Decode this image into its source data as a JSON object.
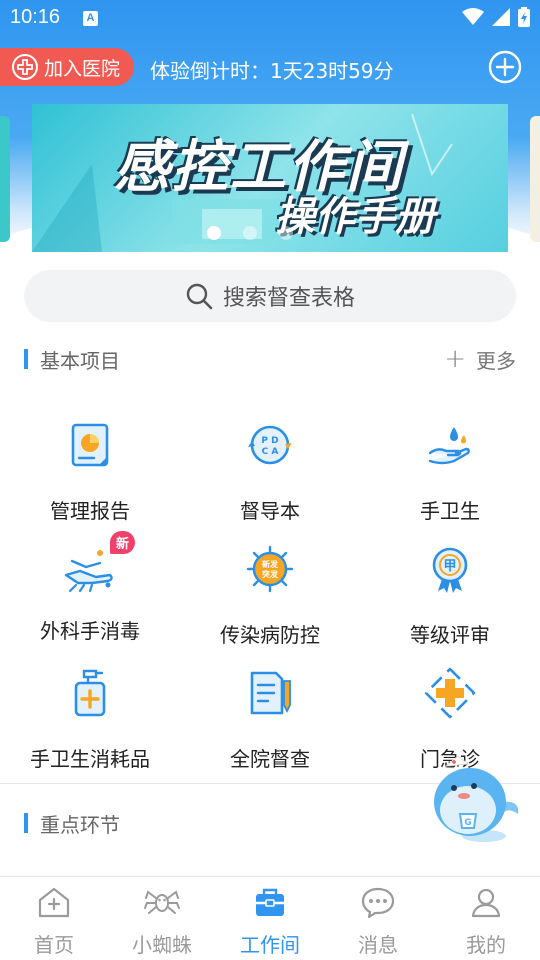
{
  "status_bar": {
    "time": "10:16",
    "notif_letter": "A"
  },
  "header": {
    "join_label": "加入医院",
    "trial_countdown": "体验倒计时：1天23时59分"
  },
  "banner": {
    "title_line1": "感控工作间",
    "title_line2": "操作手册",
    "slide_count": 3,
    "active_slide": 1
  },
  "search": {
    "placeholder": "搜索督查表格"
  },
  "section_basic": {
    "title": "基本项目",
    "more_label": "更多"
  },
  "grid_items": [
    {
      "label": "管理报告",
      "icon": "report-icon"
    },
    {
      "label": "督导本",
      "icon": "pdca-icon"
    },
    {
      "label": "手卫生",
      "icon": "hand-hygiene-icon"
    },
    {
      "label": "外科手消毒",
      "icon": "surgical-hand-icon",
      "badge": "新"
    },
    {
      "label": "传染病防控",
      "icon": "virus-icon",
      "icon_text": "新发\n突发"
    },
    {
      "label": "等级评审",
      "icon": "grade-medal-icon",
      "icon_text": "甲"
    },
    {
      "label": "手卫生消耗品",
      "icon": "sanitizer-bottle-icon"
    },
    {
      "label": "全院督查",
      "icon": "document-pen-icon"
    },
    {
      "label": "门急诊",
      "icon": "emergency-cross-icon"
    }
  ],
  "section_key": {
    "title": "重点环节"
  },
  "bottom_nav": [
    {
      "label": "首页",
      "icon": "home-icon",
      "active": false
    },
    {
      "label": "小蜘蛛",
      "icon": "spider-icon",
      "active": false
    },
    {
      "label": "工作间",
      "icon": "toolbox-icon",
      "active": true
    },
    {
      "label": "消息",
      "icon": "message-icon",
      "active": false
    },
    {
      "label": "我的",
      "icon": "profile-icon",
      "active": false
    }
  ],
  "colors": {
    "primary": "#2f95f0",
    "join_button": "#f05a53",
    "icon_blue": "#2b8fe6",
    "icon_orange": "#f6a623",
    "badge": "#f0416a"
  }
}
